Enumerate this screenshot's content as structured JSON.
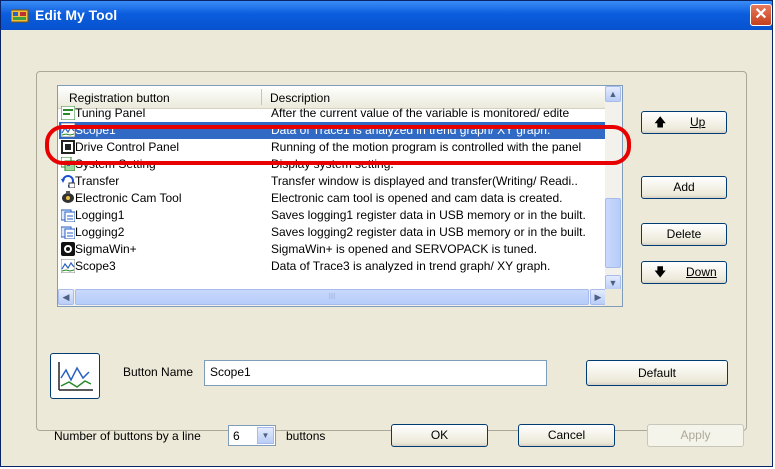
{
  "window": {
    "title": "Edit My Tool",
    "close_glyph": "✕"
  },
  "list": {
    "col_registration": "Registration button",
    "col_description": "Description",
    "rows": [
      {
        "name": "Tuning Panel",
        "desc": "After the current value of the variable is monitored/ edite",
        "icon": "tuning-panel-icon"
      },
      {
        "name": "Scope1",
        "desc": "Data of Trace1 is analyzed in trend graph/ XY graph.",
        "icon": "scope-icon",
        "selected": true
      },
      {
        "name": "Drive Control Panel",
        "desc": "Running of the motion program is controlled with the panel",
        "icon": "drive-control-icon"
      },
      {
        "name": "System Setting",
        "desc": "Display system setting.",
        "icon": "system-setting-icon"
      },
      {
        "name": "Transfer",
        "desc": "Transfer window is displayed and transfer(Writing/ Readi..",
        "icon": "transfer-icon"
      },
      {
        "name": "Electronic Cam Tool",
        "desc": "Electronic cam tool is opened and cam data is created.",
        "icon": "cam-tool-icon"
      },
      {
        "name": "Logging1",
        "desc": "Saves logging1 register data in USB memory or in the built.",
        "icon": "logging-icon"
      },
      {
        "name": "Logging2",
        "desc": "Saves logging2 register data in USB memory or in the built.",
        "icon": "logging-icon"
      },
      {
        "name": "SigmaWin+",
        "desc": "SigmaWin+ is opened and SERVOPACK is tuned.",
        "icon": "sigmawin-icon"
      },
      {
        "name": "Scope3",
        "desc": "Data of Trace3 is analyzed in trend graph/ XY graph.",
        "icon": "scope-icon"
      }
    ],
    "scroll_grip": "III"
  },
  "buttons": {
    "up": "Up",
    "add": "Add",
    "delete": "Delete",
    "down": "Down",
    "default": "Default",
    "ok": "OK",
    "cancel": "Cancel",
    "apply": "Apply"
  },
  "button_name": {
    "label": "Button Name",
    "value": "Scope1"
  },
  "per_line": {
    "label": "Number of buttons by a line",
    "value": "6",
    "suffix": "buttons"
  },
  "colors": {
    "titlebar": "#0a5ddd",
    "selection": "#316ac5",
    "highlight_ring": "#e80000"
  }
}
